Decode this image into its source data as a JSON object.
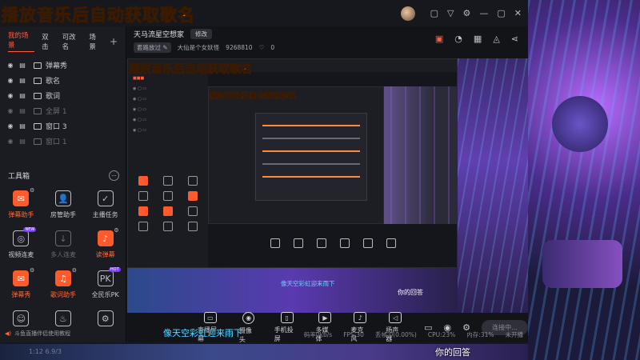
{
  "overlay_title": "播放音乐后自动获取歌名",
  "scene_tabs": [
    "我的场景",
    "双击",
    "可改名",
    "场景"
  ],
  "scene_add": "+",
  "sources": [
    {
      "label": "弹幕秀",
      "dim": false
    },
    {
      "label": "歌名",
      "dim": false
    },
    {
      "label": "歌词",
      "dim": false
    },
    {
      "label": "全屏 1",
      "dim": true
    },
    {
      "label": "窗口 3",
      "dim": false
    },
    {
      "label": "窗口 1",
      "dim": true
    }
  ],
  "toolbox_title": "工具箱",
  "tools": [
    {
      "label": "弹幕助手",
      "style": "orange",
      "glyph": "✉",
      "gear": true,
      "badge": ""
    },
    {
      "label": "房管助手",
      "style": "plain",
      "glyph": "👤",
      "gear": false,
      "badge": ""
    },
    {
      "label": "主播任务",
      "style": "plain",
      "glyph": "✓",
      "gear": false,
      "badge": ""
    },
    {
      "label": "视频连麦",
      "style": "plain",
      "glyph": "◎",
      "gear": false,
      "badge": "NEW"
    },
    {
      "label": "多人连麦",
      "style": "dim",
      "glyph": "↓",
      "gear": false,
      "badge": ""
    },
    {
      "label": "读弹幕",
      "style": "orange",
      "glyph": "♪",
      "gear": true,
      "badge": ""
    },
    {
      "label": "弹幕秀",
      "style": "orange",
      "glyph": "✉",
      "gear": true,
      "badge": ""
    },
    {
      "label": "歌词助手",
      "style": "orange",
      "glyph": "♫",
      "gear": true,
      "badge": ""
    },
    {
      "label": "全民乐PK",
      "style": "plain",
      "glyph": "PK",
      "gear": false,
      "badge": "HOT"
    },
    {
      "label": "",
      "style": "plain",
      "glyph": "☺",
      "gear": false,
      "badge": ""
    },
    {
      "label": "",
      "style": "plain",
      "glyph": "♨",
      "gear": false,
      "badge": ""
    },
    {
      "label": "",
      "style": "plain",
      "glyph": "⚙",
      "gear": false,
      "badge": ""
    }
  ],
  "left_footer": "斗鱼直播伴侣使用教程",
  "room_title": "天马流星空想家",
  "edit_label": "修改",
  "room_tag": "套路放过",
  "room_name": "大仙是个女妖怪",
  "room_id": "9268810",
  "room_likes": "0",
  "controls": [
    {
      "label": "直播屏幕",
      "glyph": "▭"
    },
    {
      "label": "摄像头",
      "glyph": "◉"
    },
    {
      "label": "手机投屏",
      "glyph": "▯"
    },
    {
      "label": "多媒体",
      "glyph": "▶"
    },
    {
      "label": "麦克风",
      "glyph": "♪"
    },
    {
      "label": "扬声器",
      "glyph": "◁"
    }
  ],
  "live_button": "连接中...",
  "lyric_main": "像天空彩虹迎来雨下",
  "lyric_answer": "你的回答",
  "status": {
    "bitrate": "码率0kb/s",
    "fps": "FPS:30",
    "drop": "丢帧:0(0.00%)",
    "cpu": "CPU:23%",
    "memory": "内存:31%",
    "quality": "未开播"
  },
  "clock": "1:12 6.9/3",
  "colors": {
    "accent": "#ff5a2c",
    "title": "#ffc21a",
    "lyric": "#5ad4ff"
  }
}
